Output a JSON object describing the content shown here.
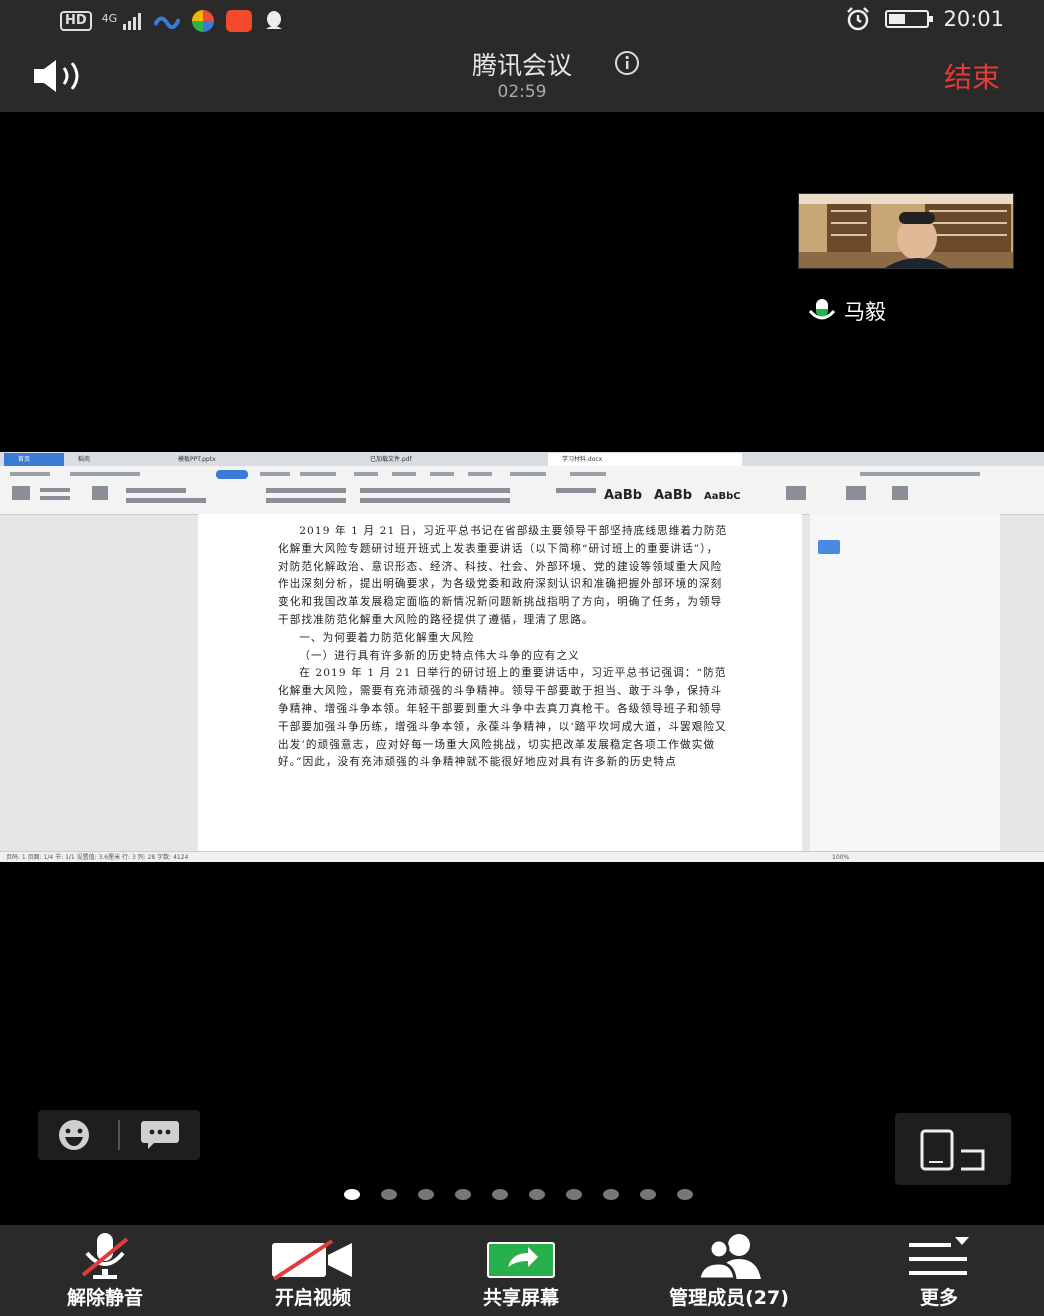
{
  "status_bar": {
    "network": "HD",
    "signal_text": "4G",
    "time": "20:01",
    "app_icons": [
      "signal-icon",
      "wave-app-icon",
      "pinwheel-app-icon",
      "fox-app-icon",
      "qq-icon"
    ],
    "alarm_icon": "alarm-clock-icon",
    "battery_level": 0.4
  },
  "header": {
    "title": "腾讯会议",
    "timer": "02:59",
    "end_label": "结束"
  },
  "participant": {
    "name": "马毅"
  },
  "shared_doc": {
    "tabs": [
      "首页",
      "稻壳",
      "模板PPT.pptx",
      "已加载文件.pdf",
      "学习材料.docx"
    ],
    "status_text": "页码: 1   页面: 1/4   节: 1/1   设置值: 3.6厘米   行: 3   列: 28   字数: 4124",
    "zoom": "100%",
    "paragraphs": [
      "2019 年 1 月 21 日，习近平总书记在省部级主要领导干部坚持底线思维着力防范化解重大风险专题研讨班开班式上发表重要讲话（以下简称“研讨班上的重要讲话”），对防范化解政治、意识形态、经济、科技、社会、外部环境、党的建设等领域重大风险作出深刻分析，提出明确要求，为各级党委和政府深刻认识和准确把握外部环境的深刻变化和我国改革发展稳定面临的新情况新问题新挑战指明了方向，明确了任务，为领导干部找准防范化解重大风险的路径提供了遵循，理清了思路。",
      "一、为何要着力防范化解重大风险",
      "（一）进行具有许多新的历史特点伟大斗争的应有之义",
      "在 2019 年 1 月 21 日举行的研讨班上的重要讲话中，习近平总书记强调：“防范化解重大风险，需要有充沛顽强的斗争精神。领导干部要敢于担当、敢于斗争，保持斗争精神、增强斗争本领。年轻干部要到重大斗争中去真刀真枪干。各级领导班子和领导干部要加强斗争历练，增强斗争本领，永葆斗争精神，以‘踏平坎坷成大道，斗罢艰险又出发’的顽强意志，应对好每一场重大风险挑战，切实把改革发展稳定各项工作做实做好。”因此，没有充沛顽强的斗争精神就不能很好地应对具有许多新的历史特点"
    ]
  },
  "page_dots": {
    "count": 10,
    "active": 0
  },
  "toolbar": {
    "items": [
      {
        "label": "解除静音",
        "icon": "muted-mic-icon"
      },
      {
        "label": "开启视频",
        "icon": "video-off-icon"
      },
      {
        "label": "共享屏幕",
        "icon": "share-screen-icon"
      },
      {
        "label": "管理成员(27)",
        "icon": "members-icon"
      },
      {
        "label": "更多",
        "icon": "more-menu-icon"
      }
    ]
  },
  "colors": {
    "accent_green": "#27b04b",
    "end_red": "#e23b3b",
    "bar_bg": "#2a2a2a"
  }
}
